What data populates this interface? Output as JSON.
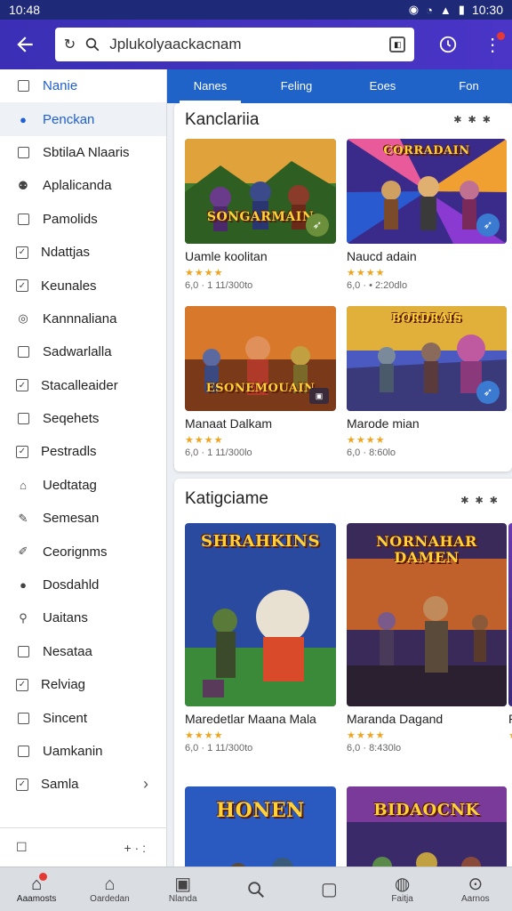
{
  "status": {
    "time_left": "10:48",
    "time_right": "10:30",
    "icons": [
      "location-icon",
      "wifi-icon",
      "signal-icon",
      "battery-icon"
    ]
  },
  "appbar": {
    "search_value": "Jplukolyaackacnam"
  },
  "sidebar": {
    "items": [
      {
        "label": "Nanie",
        "icon": "square-icon",
        "state": "active"
      },
      {
        "label": "Penckan",
        "icon": "person-icon",
        "state": "selected"
      },
      {
        "label": "SbtilaA Nlaaris",
        "icon": "square-icon"
      },
      {
        "label": "Aplalicanda",
        "icon": "users-icon"
      },
      {
        "label": "Pamolids",
        "icon": "square-icon"
      },
      {
        "label": "Ndattjas",
        "icon": "checkbox-icon"
      },
      {
        "label": "Keunales",
        "icon": "checkbox-icon"
      },
      {
        "label": "Kannnaliana",
        "icon": "circle-icon"
      },
      {
        "label": "Sadwarlalla",
        "icon": "square-icon"
      },
      {
        "label": "Stacalleaider",
        "icon": "checkbox-icon"
      },
      {
        "label": "Seqehets",
        "icon": "square-icon"
      },
      {
        "label": "Pestradls",
        "icon": "checkbox-icon"
      },
      {
        "label": "Uedtatag",
        "icon": "home-icon"
      },
      {
        "label": "Semesan",
        "icon": "pen-icon"
      },
      {
        "label": "Ceorignms",
        "icon": "pencil-icon"
      },
      {
        "label": "Dosdahld",
        "icon": "person-icon"
      },
      {
        "label": "Uaitans",
        "icon": "pin-icon"
      },
      {
        "label": "Nesataa",
        "icon": "square-icon"
      },
      {
        "label": "Relviag",
        "icon": "checkbox-icon"
      },
      {
        "label": "Sincent",
        "icon": "square-icon"
      },
      {
        "label": "Uamkanin",
        "icon": "square-icon"
      },
      {
        "label": "Samla",
        "icon": "checkbox-icon",
        "chevron": true
      }
    ],
    "bottom_right": "+ · :"
  },
  "tabs": [
    {
      "label": "Nanes",
      "active": true
    },
    {
      "label": "Feling"
    },
    {
      "label": "Eoes"
    },
    {
      "label": "Fon"
    }
  ],
  "sections": [
    {
      "title": "Kanclariia",
      "more": "✱ ✱ ✱",
      "games": [
        {
          "name": "Uamle koolitan",
          "rating": "★★★★",
          "meta": "6,0 · 1 11/300to",
          "art_title": "SONGARMAIN"
        },
        {
          "name": "Naucd adain",
          "rating": "★★★★",
          "meta": "6,0 · • 2:20dlo",
          "art_title": "CORRADAIN"
        },
        {
          "name": "Manaat Dalkam",
          "rating": "★★★★",
          "meta": "6,0 · 1 11/300lo",
          "art_title": "ESONEMOUAIN"
        },
        {
          "name": "Marode mian",
          "rating": "★★★★",
          "meta": "6,0 · 8:60lo",
          "art_title": "BORDRAIS"
        }
      ]
    },
    {
      "title": "Katigciame",
      "more": "✱ ✱ ✱",
      "games": [
        {
          "name": "Maredetlar Maana Mala",
          "rating": "★★★★",
          "meta": "6,0 · 1 11/300to",
          "art_title": "SHRAHKINS"
        },
        {
          "name": "Maranda Dagand",
          "rating": "★★★★",
          "meta": "6,0 · 8:430lo",
          "art_title": "NORNAHAR DAMEN"
        },
        {
          "name": "Ra",
          "rating": "★",
          "meta": ""
        },
        {
          "name": "",
          "rating": "",
          "meta": "",
          "art_title": "HONEN"
        },
        {
          "name": "",
          "rating": "",
          "meta": "",
          "art_title": "BIDAOCNK"
        }
      ]
    }
  ],
  "bottom_nav": [
    {
      "label": "Aaamosts",
      "icon": "home-icon",
      "active": true,
      "dot": true
    },
    {
      "label": "Oardedan",
      "icon": "house-outline-icon"
    },
    {
      "label": "Nlanda",
      "icon": "book-icon"
    },
    {
      "label": "",
      "icon": "search-icon"
    },
    {
      "label": "",
      "icon": "square-icon"
    },
    {
      "label": "Faitja",
      "icon": "globe-icon"
    },
    {
      "label": "Aarnos",
      "icon": "circle-dot-icon"
    }
  ],
  "colors": {
    "appbar": "#3a2fb5",
    "tabs": "#1f63c8",
    "accent": "#1e5fd6",
    "star": "#f2a31c"
  }
}
